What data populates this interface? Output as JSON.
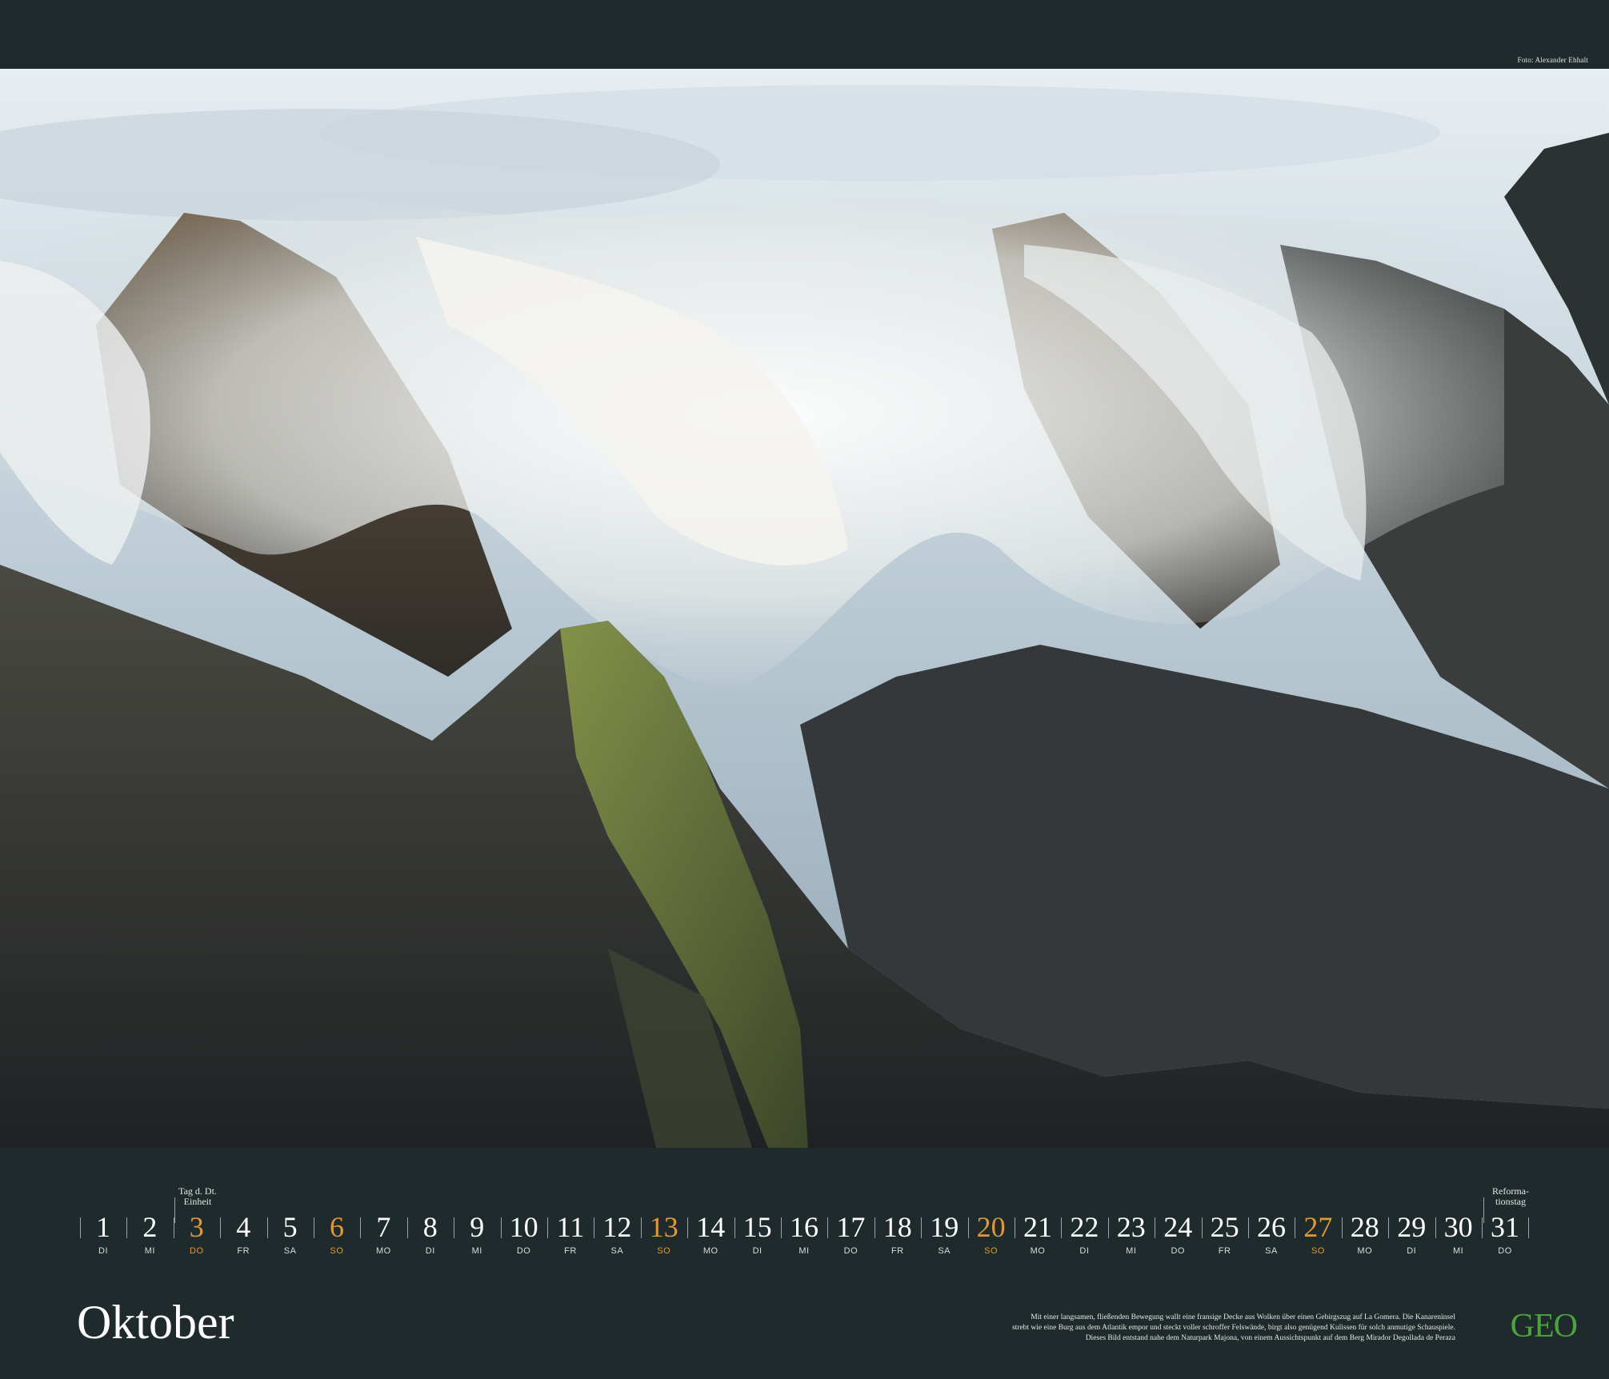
{
  "photo": {
    "credit": "Foto: Alexander Ehhalt"
  },
  "calendar": {
    "month": "Oktober",
    "days": [
      {
        "num": "1",
        "wd": "DI",
        "weekend": false
      },
      {
        "num": "2",
        "wd": "MI",
        "weekend": false
      },
      {
        "num": "3",
        "wd": "DO",
        "weekend": true
      },
      {
        "num": "4",
        "wd": "FR",
        "weekend": false
      },
      {
        "num": "5",
        "wd": "SA",
        "weekend": false
      },
      {
        "num": "6",
        "wd": "SO",
        "weekend": true
      },
      {
        "num": "7",
        "wd": "MO",
        "weekend": false
      },
      {
        "num": "8",
        "wd": "DI",
        "weekend": false
      },
      {
        "num": "9",
        "wd": "MI",
        "weekend": false
      },
      {
        "num": "10",
        "wd": "DO",
        "weekend": false
      },
      {
        "num": "11",
        "wd": "FR",
        "weekend": false
      },
      {
        "num": "12",
        "wd": "SA",
        "weekend": false
      },
      {
        "num": "13",
        "wd": "SO",
        "weekend": true
      },
      {
        "num": "14",
        "wd": "MO",
        "weekend": false
      },
      {
        "num": "15",
        "wd": "DI",
        "weekend": false
      },
      {
        "num": "16",
        "wd": "MI",
        "weekend": false
      },
      {
        "num": "17",
        "wd": "DO",
        "weekend": false
      },
      {
        "num": "18",
        "wd": "FR",
        "weekend": false
      },
      {
        "num": "19",
        "wd": "SA",
        "weekend": false
      },
      {
        "num": "20",
        "wd": "SO",
        "weekend": true
      },
      {
        "num": "21",
        "wd": "MO",
        "weekend": false
      },
      {
        "num": "22",
        "wd": "DI",
        "weekend": false
      },
      {
        "num": "23",
        "wd": "MI",
        "weekend": false
      },
      {
        "num": "24",
        "wd": "DO",
        "weekend": false
      },
      {
        "num": "25",
        "wd": "FR",
        "weekend": false
      },
      {
        "num": "26",
        "wd": "SA",
        "weekend": false
      },
      {
        "num": "27",
        "wd": "SO",
        "weekend": true
      },
      {
        "num": "28",
        "wd": "MO",
        "weekend": false
      },
      {
        "num": "29",
        "wd": "DI",
        "weekend": false
      },
      {
        "num": "30",
        "wd": "MI",
        "weekend": false
      },
      {
        "num": "31",
        "wd": "DO",
        "weekend": false
      }
    ],
    "holidays": {
      "unity_day_line1": "Tag d. Dt.",
      "unity_day_line2": "Einheit",
      "reformation_line1": "Reforma-",
      "reformation_line2": "tionstag"
    }
  },
  "caption": {
    "line1": "Mit einer langsamen, fließenden Bewegung wallt eine fransige Decke aus Wolken über einen Gebirgszug auf La Gomera. Die Kanareninsel",
    "line2": "strebt wie eine Burg aus dem Atlantik empor und steckt voller schroffer Felswände, birgt also genügend Kulissen für solch anmutige Schauspiele.",
    "line3": "Dieses Bild entstand nahe dem Naturpark Majona, von einem Aussichtspunkt auf dem Berg Mirador Degollada de Peraza"
  },
  "brand": {
    "logo": "GEO"
  },
  "colors": {
    "background": "#1f2a2c",
    "weekend_accent": "#e19a2b",
    "logo_green": "#4aa33b"
  }
}
